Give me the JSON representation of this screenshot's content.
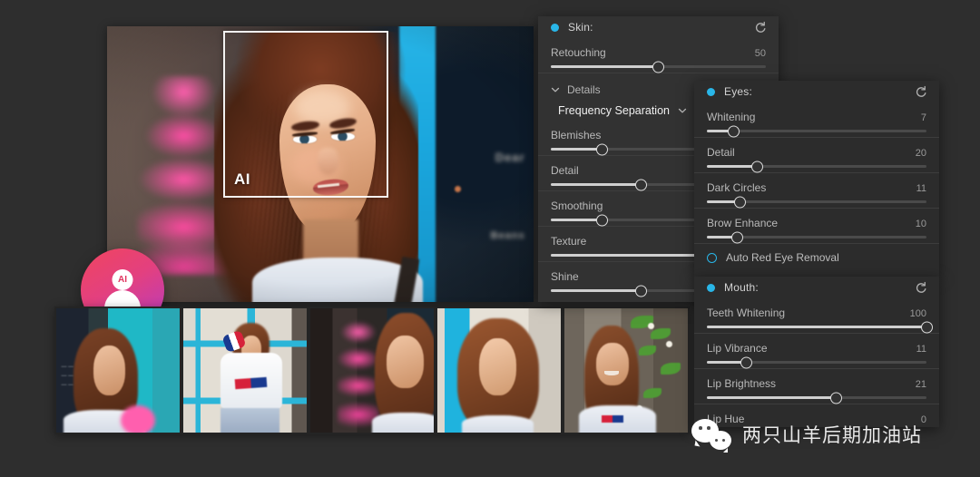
{
  "app": {
    "background_color": "#2e2e2e",
    "accent_color": "#29b6e8",
    "panel_color": "#323232"
  },
  "main_photo": {
    "face_box_label": "AI",
    "ai_badge_label": "AI",
    "sign_text_top": "Dear",
    "sign_text_bottom": "Beans"
  },
  "thumbnails": [
    {
      "label": "thumbnail-1"
    },
    {
      "label": "thumbnail-2"
    },
    {
      "label": "thumbnail-3"
    },
    {
      "label": "thumbnail-4"
    },
    {
      "label": "thumbnail-5"
    }
  ],
  "panels": {
    "skin": {
      "title": "Skin:",
      "reset_icon": "reset-icon",
      "dot_color": "#29b6e8",
      "sliders": [
        {
          "label": "Retouching",
          "value": "50",
          "percent": 50
        }
      ],
      "details": {
        "label": "Details",
        "chevron": "chevron-down-icon",
        "preset": {
          "value": "Frequency Separation",
          "chevron": "chevron-down-icon"
        },
        "sliders": [
          {
            "label": "Blemishes",
            "value": "",
            "percent": 24
          },
          {
            "label": "Detail",
            "value": "",
            "percent": 42
          },
          {
            "label": "Smoothing",
            "value": "",
            "percent": 24
          },
          {
            "label": "Texture",
            "value": "",
            "percent": 100
          },
          {
            "label": "Shine",
            "value": "",
            "percent": 42
          }
        ]
      }
    },
    "eyes": {
      "title": "Eyes:",
      "reset_icon": "reset-icon",
      "dot_color": "#29b6e8",
      "sliders": [
        {
          "label": "Whitening",
          "value": "7",
          "percent": 12
        },
        {
          "label": "Detail",
          "value": "20",
          "percent": 23
        },
        {
          "label": "Dark Circles",
          "value": "11",
          "percent": 15
        },
        {
          "label": "Brow Enhance",
          "value": "10",
          "percent": 14
        }
      ],
      "checkbox": {
        "label": "Auto Red Eye Removal",
        "checked": false
      }
    },
    "mouth": {
      "title": "Mouth:",
      "reset_icon": "reset-icon",
      "dot_color": "#29b6e8",
      "sliders": [
        {
          "label": "Teeth Whitening",
          "value": "100",
          "percent": 100
        },
        {
          "label": "Lip Vibrance",
          "value": "11",
          "percent": 18
        },
        {
          "label": "Lip Brightness",
          "value": "21",
          "percent": 59
        },
        {
          "label": "Lip Hue",
          "value": "0",
          "percent": 0
        }
      ]
    }
  },
  "watermark": {
    "icon": "wechat-icon",
    "text": "两只山羊后期加油站"
  }
}
